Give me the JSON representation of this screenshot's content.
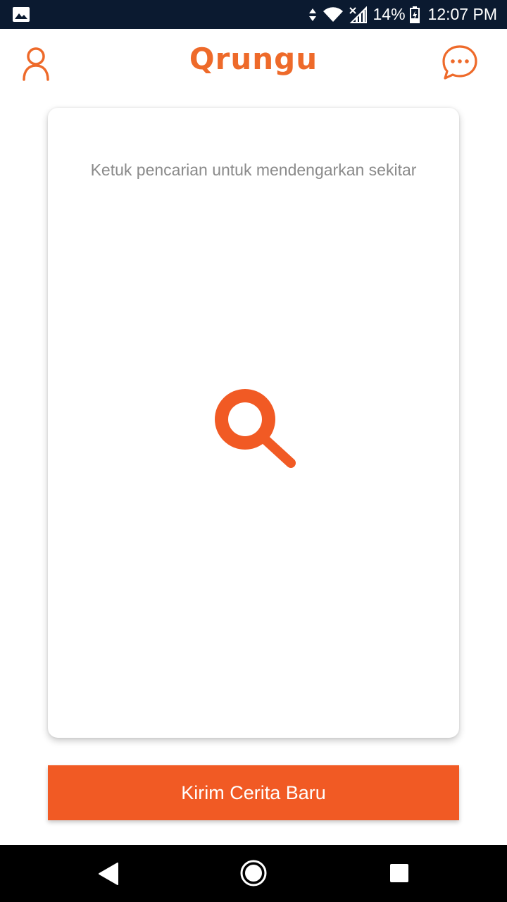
{
  "status_bar": {
    "battery_percent": "14%",
    "time": "12:07 PM",
    "icons": [
      "gallery-notification-icon",
      "data-arrows-icon",
      "wifi-icon",
      "no-sim-signal-icon",
      "battery-charging-icon"
    ]
  },
  "header": {
    "app_name": "Qrungu",
    "left_icon": "profile-icon",
    "right_icon": "chat-bubble-icon"
  },
  "card": {
    "hint_text": "Ketuk pencarian untuk mendengarkan sekitar",
    "action_icon": "search-icon"
  },
  "bottom_button": {
    "label": "Kirim Cerita Baru"
  },
  "nav_bar": {
    "icons": [
      "back-icon",
      "home-icon",
      "recents-icon"
    ]
  },
  "colors": {
    "accent": "#f15a24",
    "status_bar_bg": "#0b1a30",
    "hint_text": "#8a8a8a",
    "nav_bar_bg": "#000000"
  }
}
